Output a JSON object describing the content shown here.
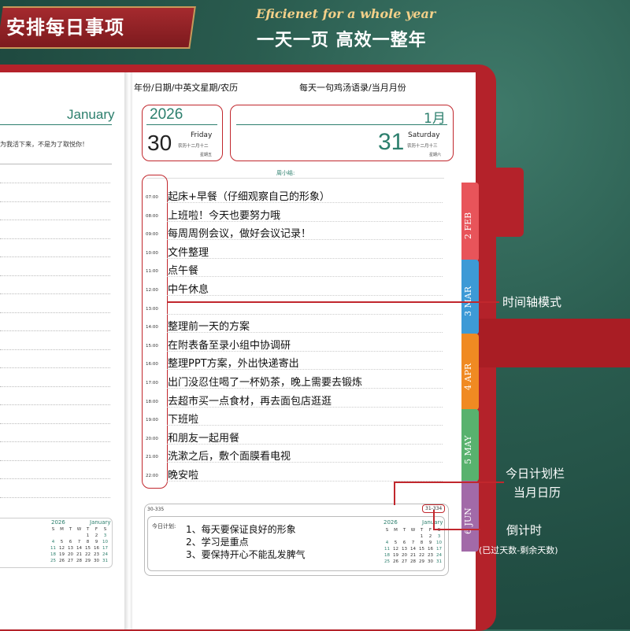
{
  "banner": {
    "title": "安排每日事项"
  },
  "slogan": {
    "en": "Eficienet for a whole year",
    "cn": "一天一页 高效一整年"
  },
  "left_page": {
    "month": "January",
    "quote": "为我活下来，不是为了取悦你！",
    "calendar": {
      "year": "2026",
      "month": "January",
      "weekdays": [
        "S",
        "M",
        "T",
        "W",
        "T",
        "F",
        "S"
      ],
      "days": [
        "",
        "",
        "",
        "",
        "1",
        "2",
        "3",
        "4",
        "5",
        "6",
        "7",
        "8",
        "9",
        "10",
        "11",
        "12",
        "13",
        "14",
        "15",
        "16",
        "17",
        "18",
        "19",
        "20",
        "21",
        "22",
        "23",
        "24",
        "25",
        "26",
        "27",
        "28",
        "29",
        "30",
        "31"
      ]
    }
  },
  "right_page": {
    "header_left": "年份/日期/中英文星期/农历",
    "header_right": "每天一句鸡汤语录/当月月份",
    "left_date": {
      "year": "2026",
      "day": "30",
      "weekday": "Friday",
      "lunar": "农历十二月十二",
      "weekday_cn": "星期五"
    },
    "right_date": {
      "month": "1月",
      "day": "31",
      "weekday": "Saturday",
      "lunar": "农历十二月十三",
      "weekday_cn": "星期六"
    },
    "weekly_summary": "周小结:",
    "schedule": [
      {
        "time": "07:00",
        "task": "起床+早餐（仔细观察自己的形象）"
      },
      {
        "time": "08:00",
        "task": "上班啦！今天也要努力哦"
      },
      {
        "time": "09:00",
        "task": "每周周例会议，做好会议记录！"
      },
      {
        "time": "10:00",
        "task": "文件整理"
      },
      {
        "time": "11:00",
        "task": "点午餐"
      },
      {
        "time": "12:00",
        "task": "中午休息"
      },
      {
        "time": "13:00",
        "task": ""
      },
      {
        "time": "14:00",
        "task": "整理前一天的方案"
      },
      {
        "time": "15:00",
        "task": "在附表备至录小组中协调研"
      },
      {
        "time": "16:00",
        "task": "整理PPT方案，外出快递寄出"
      },
      {
        "time": "17:00",
        "task": "出门没忍住喝了一杯奶茶，晚上需要去锻炼"
      },
      {
        "time": "18:00",
        "task": "去超市买一点食材，再去面包店逛逛"
      },
      {
        "time": "19:00",
        "task": "下班啦"
      },
      {
        "time": "20:00",
        "task": "和朋友一起用餐"
      },
      {
        "time": "21:00",
        "task": "洗漱之后，敷个面膜看电视"
      },
      {
        "time": "22:00",
        "task": "晚安啦"
      }
    ],
    "countdown_left": "30-335",
    "countdown_right": "31-334",
    "plan_label": "今日计划:",
    "plan_items": [
      "1、每天要保证良好的形象",
      "2、学习是重点",
      "3、要保持开心不能乱发脾气"
    ],
    "calendar": {
      "year": "2026",
      "month": "January"
    }
  },
  "tabs": [
    {
      "label": "2 FEB",
      "color": "#e8545a"
    },
    {
      "label": "3 MAR",
      "color": "#3d9ad6"
    },
    {
      "label": "4 APR",
      "color": "#f08a22"
    },
    {
      "label": "5 MAY",
      "color": "#58b26e"
    },
    {
      "label": "6 JUN",
      "color": "#a26aa8"
    }
  ],
  "annotations": {
    "timeline": "时间轴模式",
    "plan": "今日计划栏",
    "calendar": "当月日历",
    "countdown": "倒计时",
    "countdown_sub": "(已过天数-剩余天数)"
  }
}
